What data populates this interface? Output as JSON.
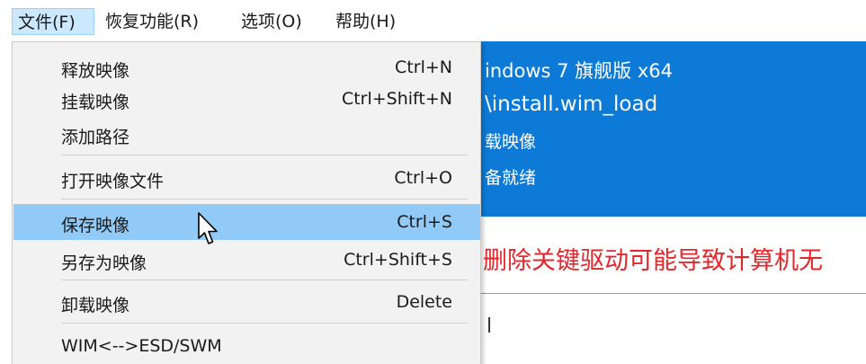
{
  "menubar": {
    "items": [
      {
        "label": "文件(F)"
      },
      {
        "label": "恢复功能(R)"
      },
      {
        "label": "选项(O)"
      },
      {
        "label": "帮助(H)"
      }
    ]
  },
  "file_menu": {
    "items": [
      {
        "label": "释放映像",
        "shortcut": "Ctrl+N"
      },
      {
        "label": "挂载映像",
        "shortcut": "Ctrl+Shift+N"
      },
      {
        "label": "添加路径",
        "shortcut": ""
      },
      {
        "label": "打开映像文件",
        "shortcut": "Ctrl+O"
      },
      {
        "label": "保存映像",
        "shortcut": "Ctrl+S"
      },
      {
        "label": "另存为映像",
        "shortcut": "Ctrl+Shift+S"
      },
      {
        "label": "卸载映像",
        "shortcut": "Delete"
      },
      {
        "label": "WIM<-->ESD/SWM",
        "shortcut": ""
      }
    ]
  },
  "info_panel": {
    "line1": "indows 7 旗舰版 x64",
    "line2": "\\install.wim_load",
    "line3": "载映像",
    "line4": "备就绪"
  },
  "warning": {
    "text": "删除关键驱动可能导致计算机无"
  },
  "background": {
    "partial_char": "l"
  },
  "colors": {
    "panel": "#0c7ad6",
    "menu_hover": "#91c9f7",
    "warning": "#e4262c"
  }
}
